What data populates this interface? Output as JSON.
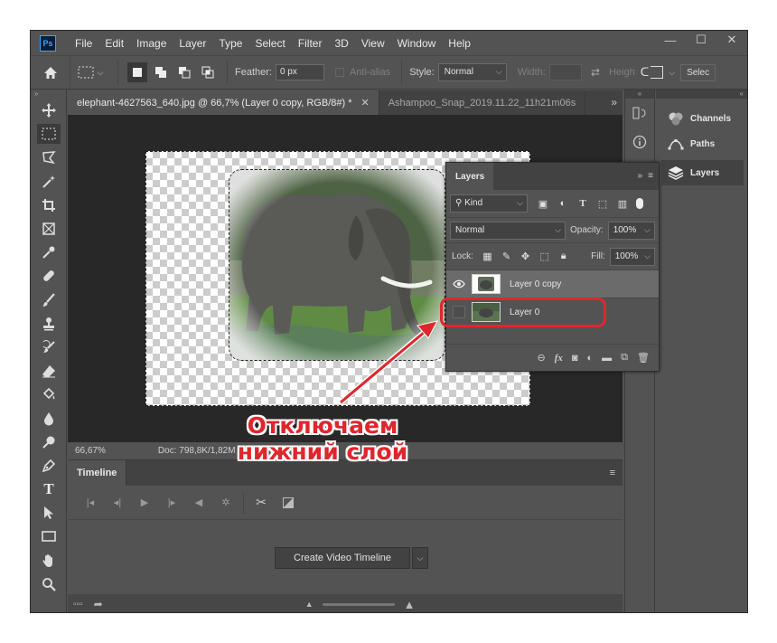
{
  "app": {
    "logo": "Ps",
    "menu": [
      "File",
      "Edit",
      "Image",
      "Layer",
      "Type",
      "Select",
      "Filter",
      "3D",
      "View",
      "Window",
      "Help"
    ]
  },
  "window_controls": {
    "minimize": "—",
    "maximize": "☐",
    "close": "✕"
  },
  "options": {
    "feather_label": "Feather:",
    "feather_value": "0 px",
    "antialias_label": "Anti-alias",
    "style_label": "Style:",
    "style_value": "Normal",
    "width_label": "Width:",
    "height_label": "Heigh",
    "select_label": "Selec"
  },
  "tabs": [
    {
      "label": "elephant-4627563_640.jpg @ 66,7% (Layer 0 copy, RGB/8#) *",
      "close": "✕"
    },
    {
      "label": "Ashampoo_Snap_2019.11.22_11h21m06s"
    }
  ],
  "status": {
    "zoom": "66,67%",
    "doc": "Doc: 798,8K/1,82M"
  },
  "timeline": {
    "title": "Timeline",
    "create_button": "Create Video Timeline"
  },
  "dock": {
    "channels": "Channels",
    "paths": "Paths",
    "layers": "Layers"
  },
  "layers_panel": {
    "title": "Layers",
    "filter_kind": "Kind",
    "blend_mode": "Normal",
    "opacity_label": "Opacity:",
    "opacity_value": "100%",
    "lock_label": "Lock:",
    "fill_label": "Fill:",
    "fill_value": "100%",
    "layers": [
      {
        "name": "Layer 0 copy",
        "visible": true
      },
      {
        "name": "Layer 0",
        "visible": false
      }
    ]
  },
  "annotation": {
    "line1": "Отключаем",
    "line2": "нижний слой",
    "color": "#e0262d"
  }
}
